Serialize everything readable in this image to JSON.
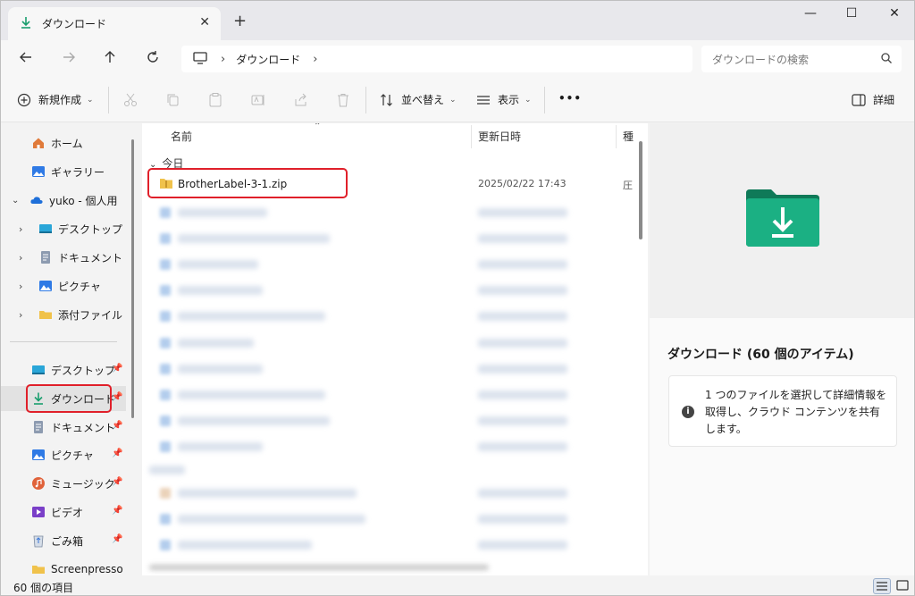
{
  "window": {
    "tab_title": "ダウンロード",
    "new_tab": "+",
    "tab_close": "✕",
    "minimize": "—",
    "maximize": "☐",
    "close": "✕"
  },
  "nav": {
    "breadcrumb": "ダウンロード",
    "search_placeholder": "ダウンロードの検索"
  },
  "toolbar": {
    "new_label": "新規作成",
    "sort_label": "並べ替え",
    "view_label": "表示",
    "more_label": "•••",
    "details_label": "詳細"
  },
  "sidebar": {
    "home": "ホーム",
    "gallery": "ギャラリー",
    "onedrive": "yuko - 個人用",
    "od_desktop": "デスクトップ",
    "od_documents": "ドキュメント",
    "od_pictures": "ピクチャ",
    "od_attachments": "添付ファイル",
    "desktop": "デスクトップ",
    "downloads": "ダウンロード",
    "documents": "ドキュメント",
    "pictures": "ピクチャ",
    "music": "ミュージック",
    "videos": "ビデオ",
    "recycle": "ごみ箱",
    "screenpresso": "Screenpresso"
  },
  "filelist": {
    "col_name": "名前",
    "col_date": "更新日時",
    "col_type": "種",
    "group_today": "今日",
    "rows": [
      {
        "name": "BrotherLabel-3-1.zip",
        "date": "2025/02/22 17:43",
        "type": "圧"
      }
    ]
  },
  "details": {
    "title": "ダウンロード (60 個のアイテム)",
    "info": "1 つのファイルを選択して詳細情報を取得し、クラウド コンテンツを共有します。"
  },
  "status": {
    "count": "60 個の項目"
  },
  "colors": {
    "accent_green": "#1a9e6e",
    "highlight_red": "#e0202a",
    "folder_yellow": "#f0c24b",
    "onedrive_blue": "#1e6fd9"
  }
}
